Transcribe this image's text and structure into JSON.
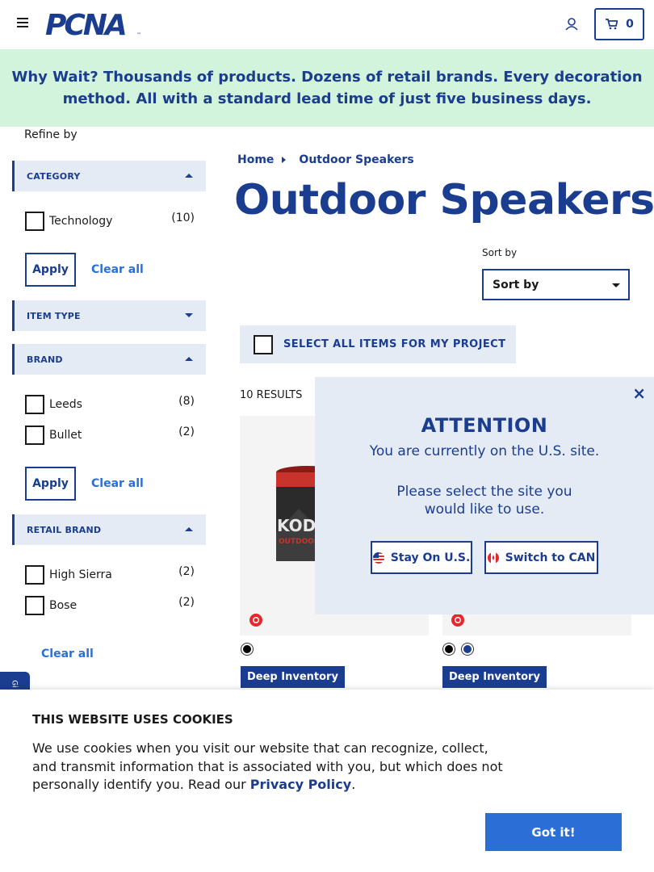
{
  "header": {
    "logo_text": "PCNA",
    "cart_count": "0"
  },
  "banner": {
    "text": "Why Wait? Thousands of products. Dozens of retail brands. Every decoration method. All with a standard lead time of just five business days."
  },
  "sidebar": {
    "refine_label": "Refine by",
    "facets": [
      {
        "title": "CATEGORY",
        "expanded": true,
        "options": [
          {
            "label": "Technology",
            "count": "(10)"
          }
        ],
        "apply_label": "Apply",
        "clear_label": "Clear all"
      },
      {
        "title": "ITEM TYPE",
        "expanded": false
      },
      {
        "title": "BRAND",
        "expanded": true,
        "options": [
          {
            "label": "Leeds",
            "count": "(8)"
          },
          {
            "label": "Bullet",
            "count": "(2)"
          }
        ],
        "apply_label": "Apply",
        "clear_label": "Clear all"
      },
      {
        "title": "RETAIL BRAND",
        "expanded": true,
        "options": [
          {
            "label": "High Sierra",
            "count": "(2)"
          },
          {
            "label": "Bose",
            "count": "(2)"
          }
        ],
        "clear_label": "Clear all"
      }
    ],
    "side_tab": "Gi"
  },
  "main": {
    "breadcrumb": {
      "home": "Home",
      "current": "Outdoor Speakers"
    },
    "title": "Outdoor Speakers",
    "sort": {
      "label": "Sort by",
      "value": "Sort by"
    },
    "select_all": "SELECT ALL ITEMS FOR MY PROJECT",
    "results": "10 RESULTS",
    "products": [
      {
        "speaker_brand": "KODIA",
        "speaker_sub": "OUTDOOR SPE",
        "swatches": [
          "#000000"
        ],
        "tag": "Deep Inventory"
      },
      {
        "swatches": [
          "#000000",
          "#1b3d8f"
        ],
        "tag": "Deep Inventory"
      }
    ]
  },
  "attention": {
    "title": "ATTENTION",
    "line1": "You are currently on the U.S. site.",
    "line2": "Please select the site you",
    "line3": "would like to use.",
    "stay_label": "Stay On U.S.",
    "switch_label": "Switch to CAN",
    "close": "×"
  },
  "cookie": {
    "title": "THIS WEBSITE USES COOKIES",
    "text": "We use cookies when you visit our website that can recognize, collect, and transmit information that is associated with you, but which does not personally identify you. Read our ",
    "link": "Privacy Policy",
    "end": ".",
    "button": "Got it!"
  },
  "colors": {
    "brand_blue": "#1b3d8f",
    "link_blue": "#2b6fd6",
    "banner_green": "#d3f4dc",
    "facet_bg": "#e5ebf5"
  }
}
